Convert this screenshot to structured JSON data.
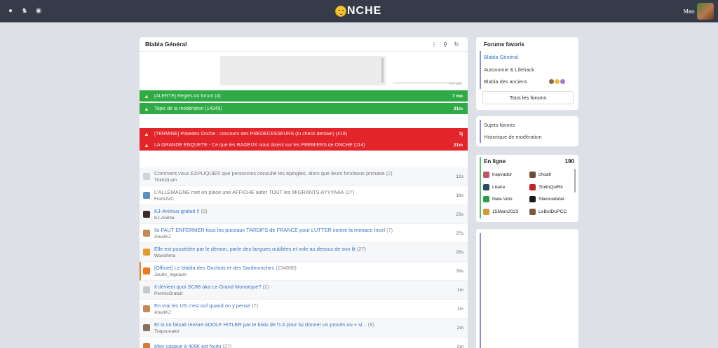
{
  "topbar": {
    "logo_text": "NCHE",
    "username": "Mao",
    "icons": [
      "lightbulb-icon",
      "bell-icon",
      "spy-icon"
    ]
  },
  "main": {
    "title": "Blabla Général",
    "header_icons": [
      "more-icon",
      "search-icon",
      "refresh-icon"
    ],
    "ad_caption": "Voir plus",
    "pinned": [
      {
        "title": "[ALERTE] Règles du forum (4)",
        "time": "7 mo",
        "color": "green"
      },
      {
        "title": "Topic de la modération (14349)",
        "time": "31m",
        "color": "green"
      },
      {
        "title": "[TERMINE] Pokedex Onche : concours des PRÉDÉCESSEURS (tu check demain) (418)",
        "time": "3j",
        "color": "red"
      },
      {
        "title": "LA GRANDE ENQUÊTE - Ce que les RAGEUX nous disent sur les PREMIERS de ONCHE (114)",
        "time": "21m",
        "color": "red"
      }
    ],
    "topics": [
      {
        "title": "Comment vous EXPLIQUER que personnes consulte les épingles, alors que leurs fonctions primaire",
        "count": "(2)",
        "author": "Tintin2Loin",
        "time": "12s",
        "read": true,
        "avatar_color": "#cfd3da"
      },
      {
        "title": "L'ALLEMAGNE met en place une AFFICHE aider TOUT les MIGRANTS AYYYAAA",
        "count": "(27)",
        "author": "FromJVC",
        "time": "18s",
        "read": true,
        "avatar_color": "#5d8fc4"
      },
      {
        "title": "KJ-Animus gratuit !!",
        "count": "(9)",
        "author": "KJ-Anima",
        "time": "23s",
        "read": false,
        "avatar_color": "#3b2a2a"
      },
      {
        "title": "Ils FAUT ENFERMER tous les puceaux TARDIFS de FRANCE pour LUTTER contre la menace Incel",
        "count": "(7)",
        "author": "AhuriKJ",
        "time": "25s",
        "read": false,
        "avatar_color": "#c48a54"
      },
      {
        "title": "Elle est possédée par le démon, parle des langues oubliées et vole au dessus de son lit",
        "count": "(27)",
        "author": "Wooohma",
        "time": "26s",
        "read": false,
        "avatar_color": "#e29a2b"
      },
      {
        "title": "[Officiel] Le blabla des Onchois et des Sardinonches",
        "count": "(134898)",
        "author": "Jouhn_Ingroum",
        "time": "33s",
        "read": false,
        "avatar_color": "#f07a1a",
        "flagged": true
      },
      {
        "title": "Il devient quoi SC88 aka Le Grand Monarque?",
        "count": "(2)",
        "author": "PermisGratuit",
        "time": "1m",
        "read": false,
        "avatar_color": "#c9c9c9"
      },
      {
        "title": "En vrai les US c'est ouf quand on y pense",
        "count": "(7)",
        "author": "AhuriKJ",
        "time": "1m",
        "read": false,
        "avatar_color": "#c48a54"
      },
      {
        "title": "Et si on faisait revivre ADOLF HITLER par le biais de l'I.A pour lui donner un procès ou + si...",
        "count": "(9)",
        "author": "Trapounator",
        "time": "2m",
        "read": false,
        "avatar_color": "#8a6f5a"
      },
      {
        "title": "Mon casque à 400€ est foutu",
        "count": "(27)",
        "author": "",
        "time": "2m",
        "read": false,
        "avatar_color": "#d47a3a"
      }
    ]
  },
  "sidebar": {
    "favorites": {
      "title": "Forums favoris",
      "items": [
        "Blabla Général",
        "Autonomie & Lifehack",
        "Blabla des anciens"
      ],
      "all_button": "Tous les forums"
    },
    "links": {
      "items": [
        "Sujets favoris",
        "Historique de modération"
      ]
    },
    "online": {
      "title": "En ligne",
      "count": "190",
      "users": [
        {
          "name": "trapvador",
          "color": "#c0556a"
        },
        {
          "name": "choah",
          "color": "#6b4e3a"
        },
        {
          "name": "Litaire",
          "color": "#2e4a5e"
        },
        {
          "name": "TintinQuiRit",
          "color": "#c0202a"
        },
        {
          "name": "New-Volo",
          "color": "#2f9a4a"
        },
        {
          "name": "Silencedeter",
          "color": "#1a1a1a"
        },
        {
          "name": "15Mars2023",
          "color": "#d09a3a"
        },
        {
          "name": "LeBotDuPCC",
          "color": "#7a5a40"
        }
      ]
    }
  },
  "colors": {
    "topbar": "#353b48",
    "background": "#dde0e7",
    "pinned_green": "#2fab46",
    "pinned_red": "#e3242b",
    "link_blue": "#3a75c4",
    "accent_purple": "#8f8ce0"
  }
}
